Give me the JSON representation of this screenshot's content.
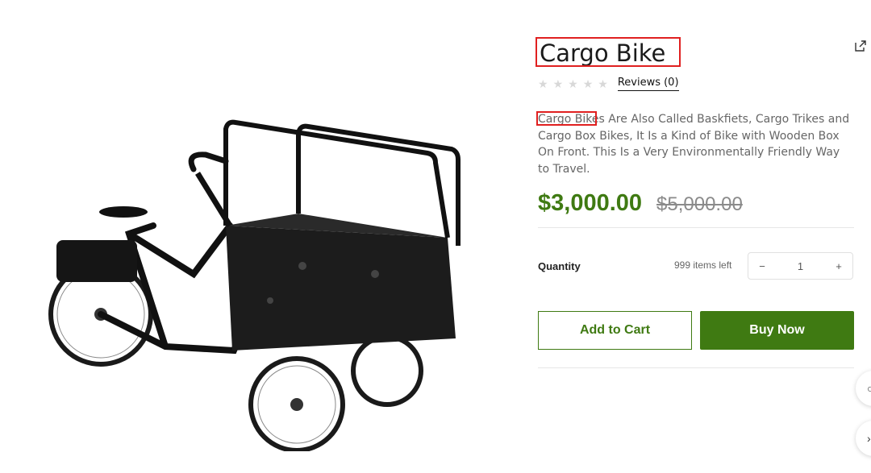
{
  "product": {
    "title": "Cargo Bike",
    "reviews_label": "Reviews (0)",
    "rating_stars": 0,
    "description_highlight": "Cargo Bike",
    "description_rest": "s Are Also Called Baskfiets, Cargo Trikes and Cargo Box Bikes, It Is a Kind of Bike with Wooden Box On Front. This Is a Very Environmentally Friendly Way to Travel.",
    "price": "$3,000.00",
    "old_price": "$5,000.00"
  },
  "quantity": {
    "label": "Quantity",
    "stock_text": "999 items left",
    "value": "1",
    "minus": "−",
    "plus": "+"
  },
  "actions": {
    "add_to_cart": "Add to Cart",
    "buy_now": "Buy Now"
  },
  "colors": {
    "accent": "#3f7a12",
    "highlight_box": "#e02020"
  },
  "icons": {
    "share": "share-icon",
    "star": "star-icon"
  }
}
